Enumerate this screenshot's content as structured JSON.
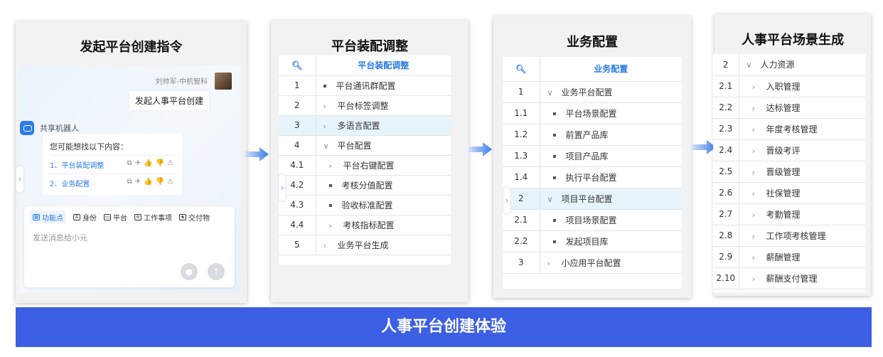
{
  "panels": {
    "p1_title": "发起平台创建指令",
    "p2_title": "平台装配调整",
    "p3_title": "业务配置",
    "p4_title": "人事平台场景生成"
  },
  "chat": {
    "user_name": "刘帅军-中机智科",
    "user_message": "发起人事平台创建",
    "bot_name": "共享机器人",
    "bot_hint": "您可能想找以下内容：",
    "option1": "1、平台装配调整",
    "option2": "2、业务配置",
    "tabs": [
      "功能点",
      "身份",
      "平台",
      "工作事项",
      "交付物"
    ],
    "placeholder": "发送消息给小元"
  },
  "table2": {
    "header": "平台装配调整",
    "rows": [
      {
        "num": "1",
        "mark": "dot",
        "label": "平台通讯群配置"
      },
      {
        "num": "2",
        "mark": ">",
        "label": "平台标签调整"
      },
      {
        "num": "3",
        "mark": ">",
        "label": "多语言配置",
        "selected": true
      },
      {
        "num": "4",
        "mark": "v",
        "label": "平台配置"
      },
      {
        "num": "4.1",
        "mark": ">",
        "label": "平台右键配置",
        "indent": true
      },
      {
        "num": "4.2",
        "mark": "dot",
        "label": "考核分值配置",
        "indent": true
      },
      {
        "num": "4.3",
        "mark": "dot",
        "label": "验收标准配置",
        "indent": true
      },
      {
        "num": "4.4",
        "mark": ">",
        "label": "考核指标配置",
        "indent": true
      },
      {
        "num": "5",
        "mark": ">",
        "label": "业务平台生成"
      }
    ]
  },
  "table3": {
    "header": "业务配置",
    "rows": [
      {
        "num": "1",
        "mark": "v",
        "label": "业务平台配置"
      },
      {
        "num": "1.1",
        "mark": "dot",
        "label": "平台场景配置",
        "indent": true
      },
      {
        "num": "1.2",
        "mark": "dot",
        "label": "前置产品库",
        "indent": true
      },
      {
        "num": "1.3",
        "mark": "dot",
        "label": "项目产品库",
        "indent": true
      },
      {
        "num": "1.4",
        "mark": "dot",
        "label": "执行平台配置",
        "indent": true
      },
      {
        "num": "2",
        "mark": "v",
        "label": "项目平台配置",
        "selected": true
      },
      {
        "num": "2.1",
        "mark": "dot",
        "label": "项目场景配置",
        "indent": true
      },
      {
        "num": "2.2",
        "mark": "dot",
        "label": "发起项目库",
        "indent": true
      },
      {
        "num": "3",
        "mark": ">",
        "label": "小应用平台配置"
      }
    ]
  },
  "table4": {
    "rows": [
      {
        "num": "2",
        "mark": "v",
        "label": "人力资源"
      },
      {
        "num": "2.1",
        "mark": ">",
        "label": "入职管理",
        "indent": true
      },
      {
        "num": "2.2",
        "mark": ">",
        "label": "达标管理",
        "indent": true
      },
      {
        "num": "2.3",
        "mark": ">",
        "label": "年度考核管理",
        "indent": true
      },
      {
        "num": "2.4",
        "mark": ">",
        "label": "晋级考评",
        "indent": true
      },
      {
        "num": "2.5",
        "mark": ">",
        "label": "晋级管理",
        "indent": true
      },
      {
        "num": "2.6",
        "mark": ">",
        "label": "社保管理",
        "indent": true
      },
      {
        "num": "2.7",
        "mark": ">",
        "label": "考勤管理",
        "indent": true
      },
      {
        "num": "2.8",
        "mark": ">",
        "label": "工作项考核管理",
        "indent": true
      },
      {
        "num": "2.9",
        "mark": ">",
        "label": "薪酬管理",
        "indent": true
      },
      {
        "num": "2.10",
        "mark": ">",
        "label": "薪酬支付管理",
        "indent": true
      }
    ]
  },
  "banner": "人事平台创建体验",
  "colors": {
    "accent": "#2b7be4",
    "banner": "#3d5fe3",
    "selected_row": "#e8f4fc"
  }
}
